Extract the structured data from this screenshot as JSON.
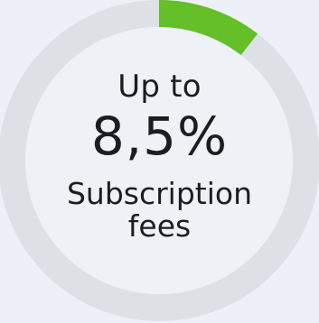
{
  "widget": {
    "line_top": "Up to",
    "value": "8,5%",
    "line_sub1": "Subscription",
    "line_sub2": "fees"
  },
  "ring": {
    "progress_fraction": 0.105,
    "track_color": "#dde1e5",
    "fill_color": "#64bf28",
    "inner_color": "#eef2f6",
    "background_color": "#eef0f7"
  }
}
